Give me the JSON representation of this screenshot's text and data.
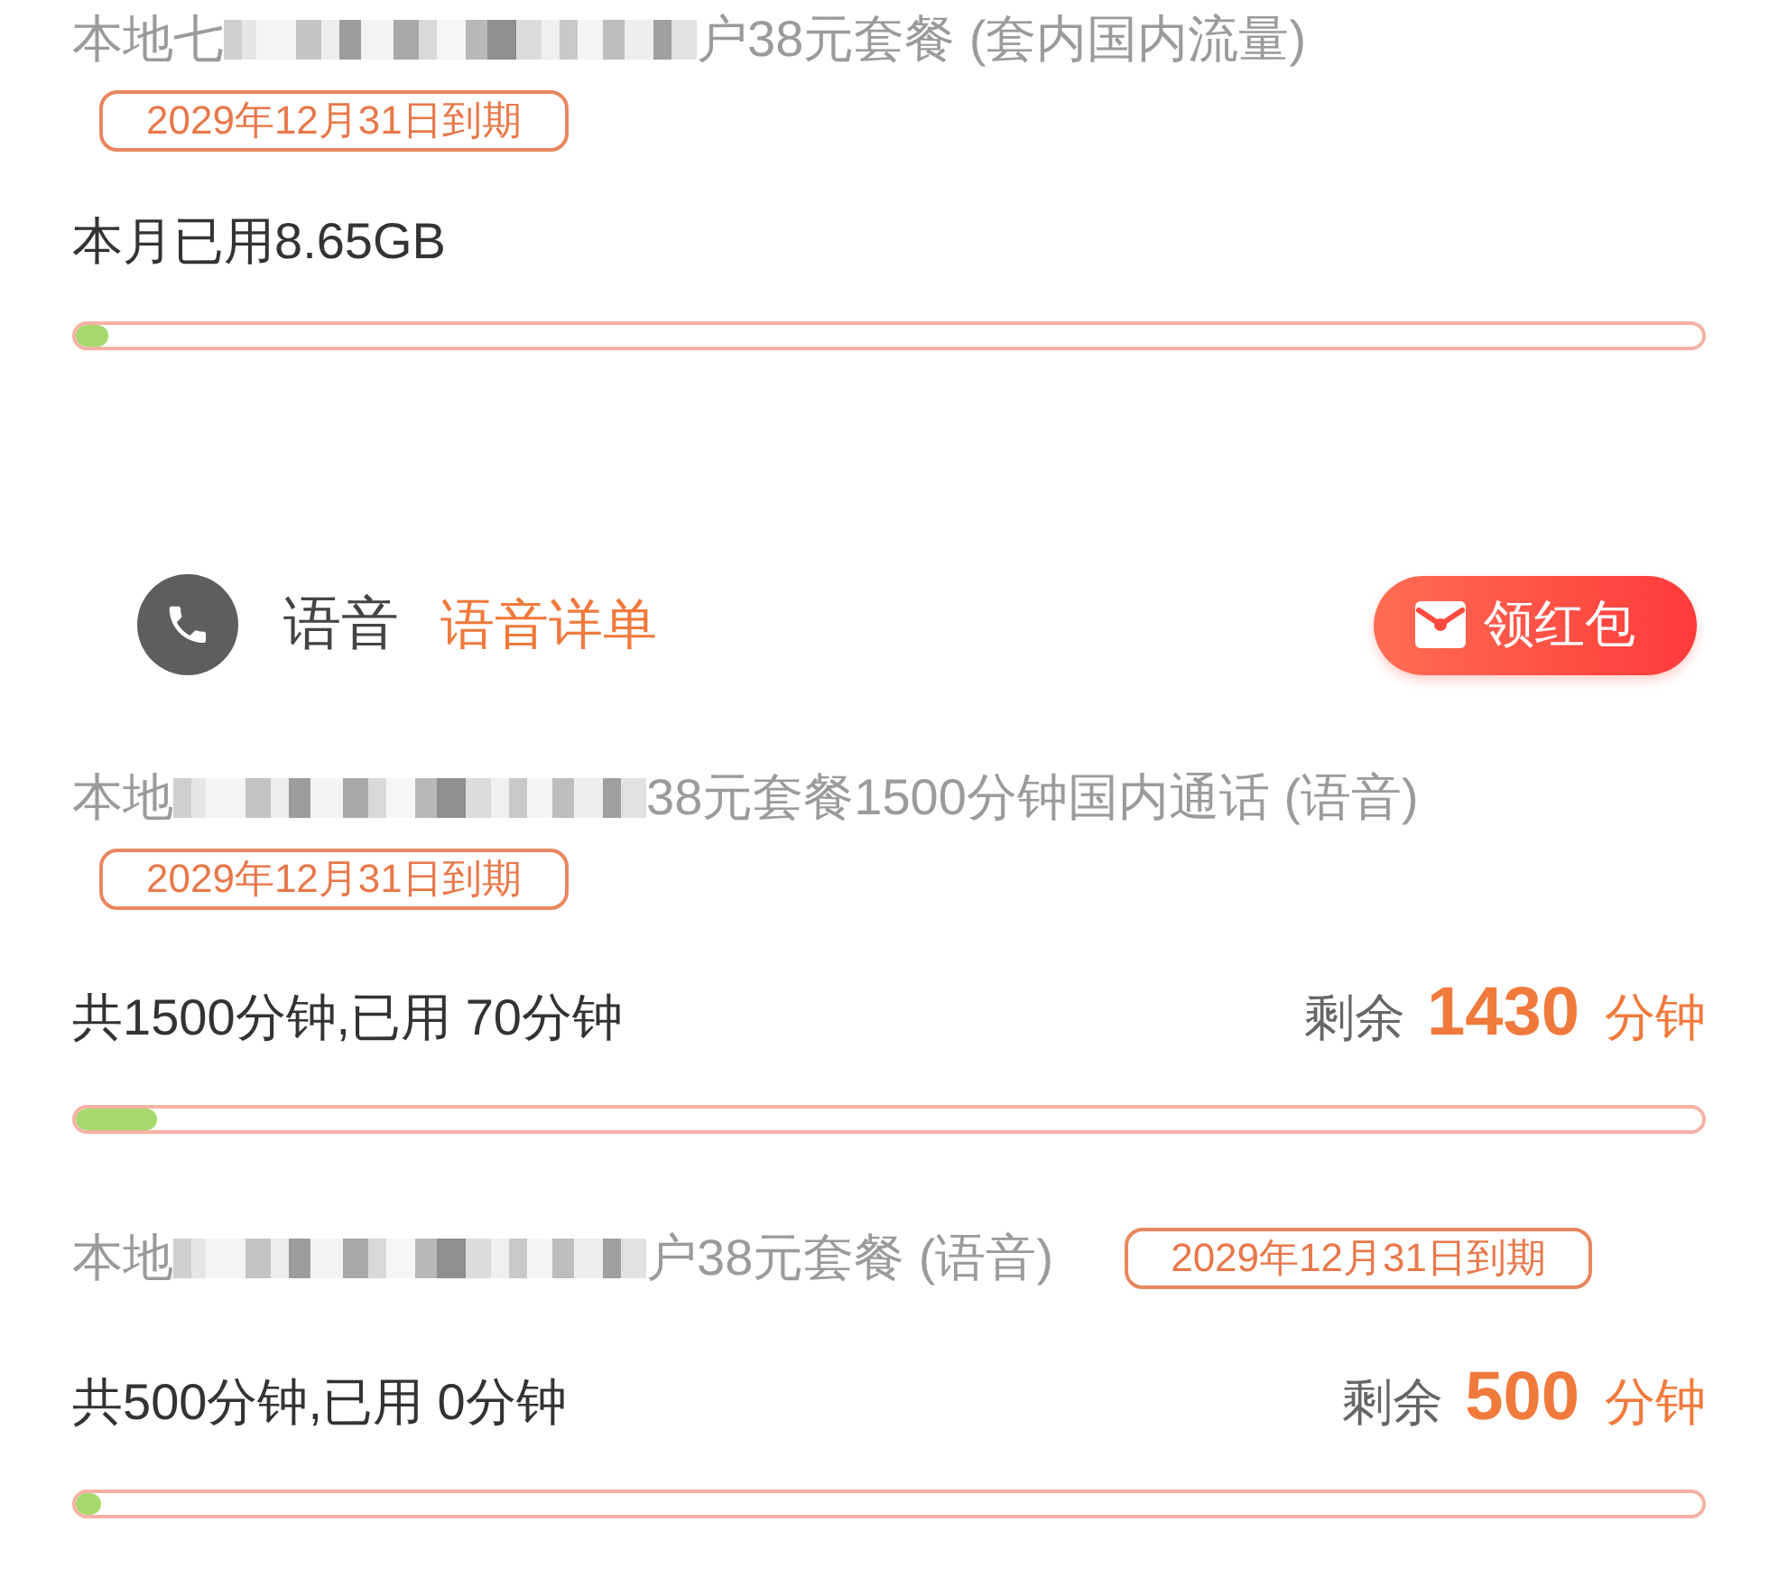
{
  "data_section": {
    "plans": [
      {
        "name_before_mask": "本地七",
        "masked": true,
        "name_after_mask": "户38元套餐 (套内国内流量)",
        "expiry": "2029年12月31日到期",
        "usage": "本月已用8.65GB",
        "level": 0.02
      }
    ]
  },
  "voice_section": {
    "title": "语音",
    "detail_link": "语音详单",
    "red_packet_button": "领红包",
    "plans": [
      {
        "name_before_mask": "本地",
        "masked": true,
        "name_after_mask": "38元套餐1500分钟国内通话 (语音)",
        "expiry": "2029年12月31日到期",
        "usage": "共1500分钟,已用 70分钟",
        "remaining_label": "剩余",
        "remaining_value": "1430",
        "remaining_unit": "分钟",
        "level": 0.05
      },
      {
        "name_before_mask": "本地",
        "masked": true,
        "name_after_mask": "户38元套餐 (语音)",
        "expiry": "2029年12月31日到期",
        "usage": "共500分钟,已用 0分钟",
        "remaining_label": "剩余",
        "remaining_value": "500",
        "remaining_unit": "分钟",
        "level": 0
      }
    ]
  }
}
